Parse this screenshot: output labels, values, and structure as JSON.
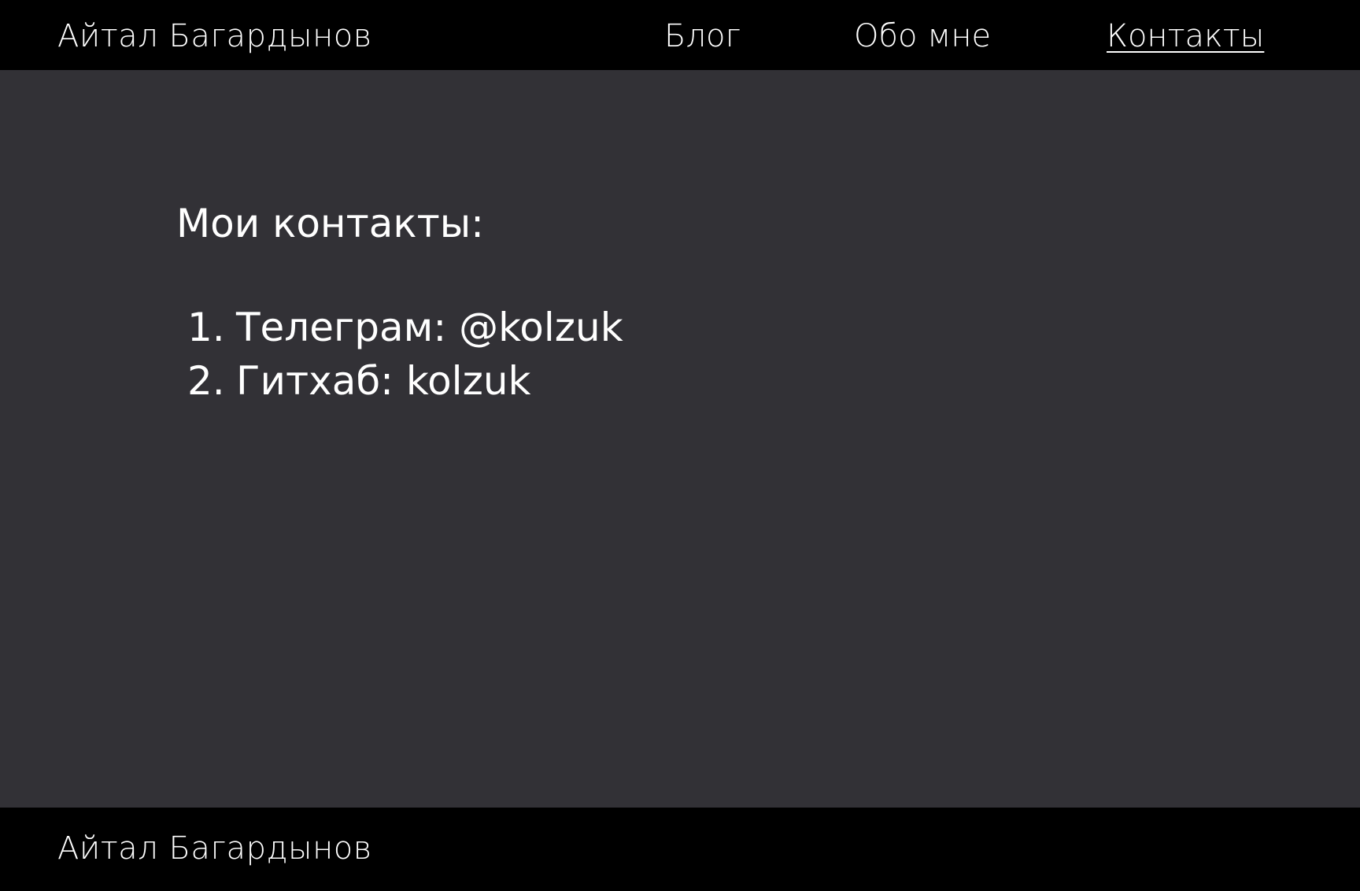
{
  "header": {
    "site_name": "Айтал Багардынов",
    "nav": {
      "blog": "Блог",
      "about": "Обо мне",
      "contacts": "Контакты"
    }
  },
  "main": {
    "heading": "Мои контакты:",
    "contacts": [
      {
        "number": "1.",
        "text": "Телеграм: @kolzuk"
      },
      {
        "number": "2.",
        "text": "Гитхаб: kolzuk"
      }
    ]
  },
  "footer": {
    "site_name": "Айтал Багардынов"
  },
  "colors": {
    "header_bg": "#000000",
    "main_bg": "#323136",
    "text": "#ffffff"
  }
}
